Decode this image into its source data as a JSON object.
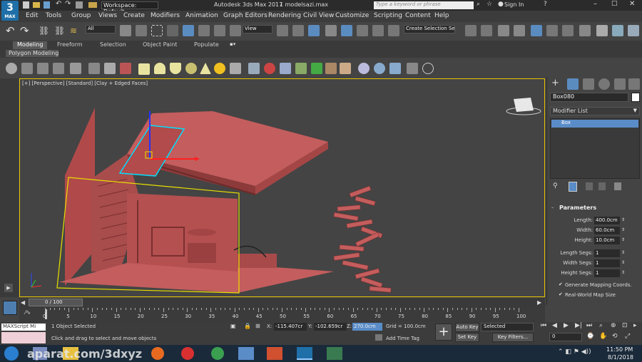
{
  "app": {
    "logo_text": "3",
    "logo_sub": "MAX",
    "workspace": "Workspace: Default",
    "title": "Autodesk 3ds Max 2017",
    "file": "1 modelsazi.max",
    "search_placeholder": "Type a keyword or phrase",
    "sign_in": "Sign In"
  },
  "menu": [
    "Edit",
    "Tools",
    "Group",
    "Views",
    "Create",
    "Modifiers",
    "Animation",
    "Graph Editors",
    "Rendering",
    "Civil View",
    "Customize",
    "Scripting",
    "Content",
    "Help"
  ],
  "toolbar": {
    "filter": "All",
    "ref_coord": "View",
    "selection_set": "Create Selection Se"
  },
  "ribbon": {
    "tabs": [
      "Modeling",
      "Freeform",
      "Selection",
      "Object Paint",
      "Populate"
    ],
    "active_panel": "Polygon Modeling"
  },
  "viewport": {
    "label": "[+] [Perspective] [Standard] [Clay + Edged Faces]"
  },
  "command_panel": {
    "object_name": "Box080",
    "modifier_list": "Modifier List",
    "stack_item": "Box",
    "params_title": "Parameters",
    "params": [
      {
        "label": "Length:",
        "value": "400.0cm"
      },
      {
        "label": "Width:",
        "value": "60.0cm"
      },
      {
        "label": "Height:",
        "value": "10.0cm"
      },
      {
        "label": "Length Segs:",
        "value": "1"
      },
      {
        "label": "Width Segs:",
        "value": "1"
      },
      {
        "label": "Height Segs:",
        "value": "1"
      }
    ],
    "checkboxes": [
      "Generate Mapping Coords.",
      "Real-World Map Size"
    ]
  },
  "timeline": {
    "position": "0 / 100",
    "ticks": [
      "0",
      "5",
      "10",
      "15",
      "20",
      "25",
      "30",
      "35",
      "40",
      "45",
      "50",
      "55",
      "60",
      "65",
      "70",
      "75",
      "80",
      "85",
      "90",
      "95",
      "100"
    ]
  },
  "status": {
    "maxscript": "MAXScript Mi",
    "selected": "1 Object Selected",
    "prompt": "Click and drag to select and move objects",
    "x_label": "X:",
    "x": "-115.407cr",
    "y_label": "Y:",
    "y": "-102.659cr",
    "z_label": "Z:",
    "z": "270.0cm",
    "grid": "Grid = 100.0cm",
    "add_time_tag": "Add Time Tag",
    "auto_key": "Auto Key",
    "set_key": "Set Key",
    "key_mode": "Selected",
    "key_filters": "Key Filters...",
    "frame": "0"
  },
  "taskbar": {
    "watermark": "aparat.com/3dxyz",
    "time": "11:50 PM",
    "date": "8/1/2018"
  },
  "colors": {
    "model": "#b85454",
    "selection": "#e8e000",
    "accent": "#1f6fa8",
    "panel": "#444444"
  }
}
